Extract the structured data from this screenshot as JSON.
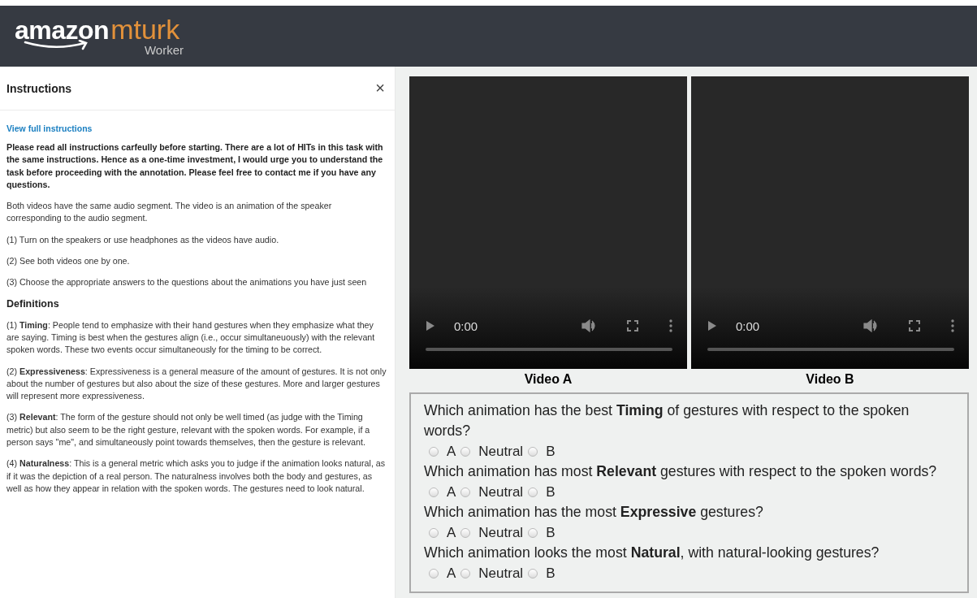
{
  "header": {
    "logo": {
      "brand": "amazon",
      "product": "mturk",
      "subtitle": "Worker"
    }
  },
  "instructions": {
    "title": "Instructions",
    "close": "×",
    "link": "View full instructions",
    "blocks": [
      {
        "kind": "strong",
        "text": "Please read all instructions carfeully before starting. There are a lot of HITs in this task with the same instructions. Hence as a one-time investment, I would urge you to understand the task before proceeding with the annotation. Please feel free to contact me if you have any questions."
      },
      {
        "kind": "text",
        "text": "Both videos have the same audio segment. The video is an animation of the speaker corresponding to the audio segment."
      },
      {
        "kind": "text",
        "text": "(1) Turn on the speakers or use headphones as the videos have audio."
      },
      {
        "kind": "text",
        "text": "(2) See both videos one by one."
      },
      {
        "kind": "text",
        "text": "(3) Choose the appropriate answers to the questions about the animations you have just seen"
      },
      {
        "kind": "heading",
        "text": "Definitions"
      },
      {
        "kind": "text",
        "text": "(1) **Timing**: People tend to emphasize with their hand gestures when they emphasize what they are saying. Timing is best when the gestures align (i.e., occur simultaneuously) with the relevant spoken words. These two events occur simultaneously for the timing to be correct."
      },
      {
        "kind": "text",
        "text": "(2) **Expressiveness**: Expressiveness is a general measure of the amount of gestures. It is not only about the number of gestures but also about the size of these gestures. More and larger gestures will represent more expressiveness."
      },
      {
        "kind": "text",
        "text": "(3) **Relevant**: The form of the gesture should not only be well timed (as judge with the Timing metric) but also seem to be the right gesture, relevant with the spoken words. For example, if a person says \"me\", and simultaneously point towards themselves, then the gesture is relevant."
      },
      {
        "kind": "text",
        "text": "(4) **Naturalness**: This is a general metric which asks you to judge if the animation looks natural, as if it was the depiction of a real person. The naturalness involves both the body and gestures, as well as how they appear in relation with the spoken words. The gestures need to look natural."
      }
    ]
  },
  "videos": [
    {
      "label": "Video A",
      "time": "0:00",
      "level": 0
    },
    {
      "label": "Video B",
      "time": "0:00",
      "level": 0
    }
  ],
  "questions": [
    {
      "text": "Which animation has the best **Timing** of gestures with respect to the spoken words?",
      "options": [
        {
          "label": "A",
          "selected": false
        },
        {
          "label": "Neutral",
          "selected": false
        },
        {
          "label": "B",
          "selected": false
        }
      ]
    },
    {
      "text": "Which animation has most **Relevant** gestures with respect to the spoken words?",
      "options": [
        {
          "label": "A",
          "selected": false
        },
        {
          "label": "Neutral",
          "selected": false
        },
        {
          "label": "B",
          "selected": false
        }
      ]
    },
    {
      "text": "Which animation has the most **Expressive** gestures?",
      "options": [
        {
          "label": "A",
          "selected": false
        },
        {
          "label": "Neutral",
          "selected": false
        },
        {
          "label": "B",
          "selected": false
        }
      ]
    },
    {
      "text": "Which animation looks the most **Natural**, with natural-looking gestures?",
      "options": [
        {
          "label": "A",
          "selected": false
        },
        {
          "label": "Neutral",
          "selected": false
        },
        {
          "label": "B",
          "selected": false
        }
      ]
    }
  ]
}
